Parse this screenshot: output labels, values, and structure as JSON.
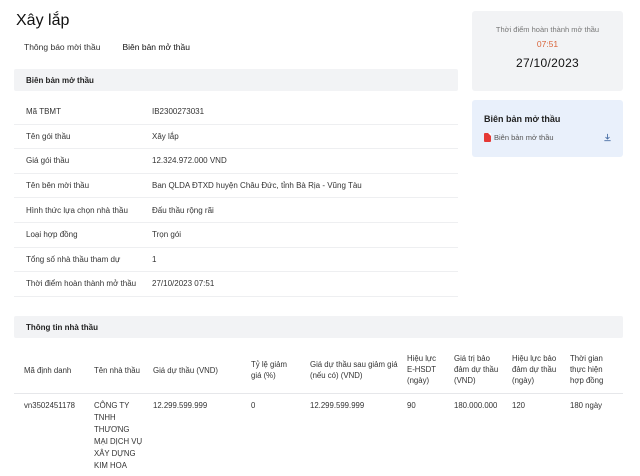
{
  "page": {
    "title": "Xây lắp"
  },
  "tabs": [
    {
      "label": "Thông báo mời thầu"
    },
    {
      "label": "Biên bản mở thầu"
    }
  ],
  "section1": {
    "heading": "Biên bản mở thầu",
    "rows": [
      {
        "label": "Mã TBMT",
        "value": "IB2300273031"
      },
      {
        "label": "Tên gói thầu",
        "value": "Xây lắp"
      },
      {
        "label": "Giá gói thầu",
        "value": "12.324.972.000 VND"
      },
      {
        "label": "Tên bên mời thầu",
        "value": "Ban QLDA ĐTXD huyện Châu Đức, tỉnh Bà Rịa - Vũng Tàu"
      },
      {
        "label": "Hình thức lựa chọn nhà thầu",
        "value": "Đấu thầu rộng rãi"
      },
      {
        "label": "Loại hợp đồng",
        "value": "Trọn gói"
      },
      {
        "label": "Tổng số nhà thầu tham dự",
        "value": "1"
      },
      {
        "label": "Thời điểm hoàn thành mở thầu",
        "value": "27/10/2023 07:51"
      }
    ]
  },
  "completion_card": {
    "label": "Thời điểm hoàn thành mở thầu",
    "time": "07:51",
    "date": "27/10/2023"
  },
  "doc_card": {
    "title": "Biên bản mở thầu",
    "file_label": "Biên bản mở thầu",
    "icons": {
      "file": "pdf-icon",
      "action": "download-icon"
    },
    "colors": {
      "pdf": "#e53935",
      "accent": "#d9643a"
    }
  },
  "section2": {
    "heading": "Thông tin nhà thầu",
    "columns": [
      [
        "Mã định danh"
      ],
      [
        "Tên nhà thầu"
      ],
      [
        "Giá dự thầu (VND)"
      ],
      [
        "Tỷ lệ giảm",
        "giá (%)"
      ],
      [
        "Giá dự thầu sau giảm giá",
        "(nếu có) (VND)"
      ],
      [
        "Hiệu lực",
        "E-HSDT",
        "(ngày)"
      ],
      [
        "Giá trị bảo",
        "đảm dự thầu",
        "(VND)"
      ],
      [
        "Hiệu lực bảo",
        "đảm dự thầu",
        "(ngày)"
      ],
      [
        "Thời gian",
        "thực hiện",
        "hợp đồng"
      ]
    ],
    "rows": [
      {
        "cells": [
          [
            "vn3502451178"
          ],
          [
            "CÔNG TY",
            "TNHH",
            "THƯƠNG",
            "MẠI DỊCH VỤ",
            "XÂY DỰNG",
            "KIM HOA"
          ],
          [
            "12.299.599.999"
          ],
          [
            "0"
          ],
          [
            "12.299.599.999"
          ],
          [
            "90"
          ],
          [
            "180.000.000"
          ],
          [
            "120"
          ],
          [
            "180 ngày"
          ]
        ]
      }
    ]
  }
}
